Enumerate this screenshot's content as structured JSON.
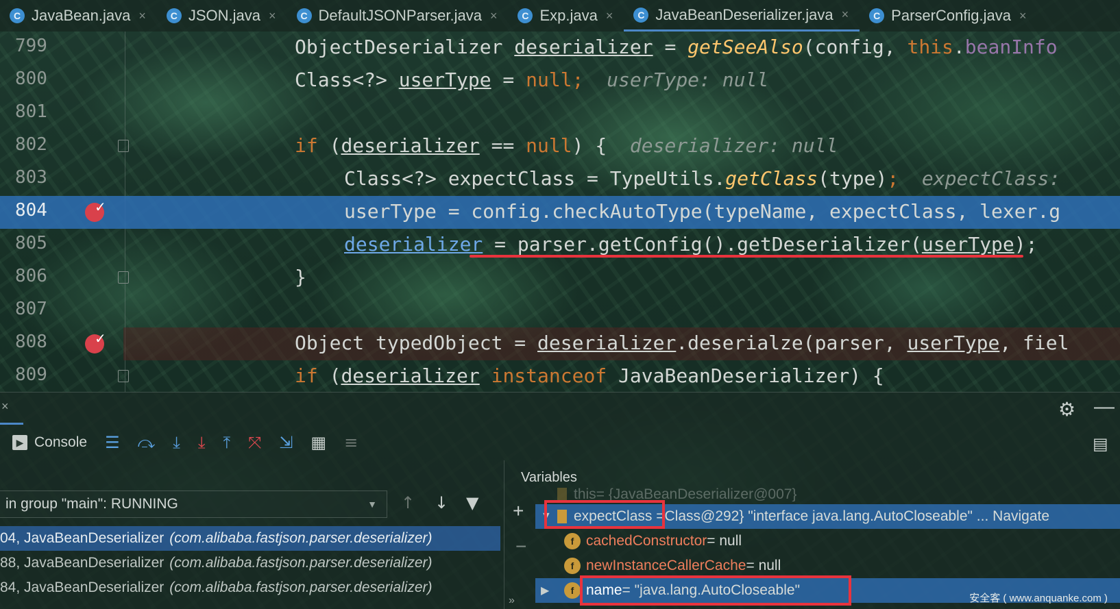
{
  "tabs": [
    {
      "icon": "C",
      "label": "JavaBean.java",
      "close": "×"
    },
    {
      "icon": "C",
      "label": "JSON.java",
      "close": "×"
    },
    {
      "icon": "C",
      "label": "DefaultJSONParser.java",
      "close": "×"
    },
    {
      "icon": "C",
      "label": "Exp.java",
      "close": "×"
    },
    {
      "icon": "C",
      "label": "JavaBeanDeserializer.java",
      "close": "×"
    },
    {
      "icon": "C",
      "label": "ParserConfig.java",
      "close": "×"
    }
  ],
  "editor": {
    "line_numbers": [
      "799",
      "800",
      "801",
      "802",
      "803",
      "804",
      "805",
      "806",
      "807",
      "808",
      "809"
    ],
    "l799": {
      "a": "ObjectDeserializer ",
      "b": "deserializer",
      "c": " = ",
      "d": "getSeeAlso",
      "e": "(config, ",
      "f": "this",
      "g": ".",
      "h": "beanInfo"
    },
    "l800": {
      "a": "Class<?> ",
      "b": "userType",
      "c": " = ",
      "d": "null",
      "e": ";",
      "hint": "userType: null"
    },
    "l802": {
      "a": "if",
      "b": " (",
      "c": "deserializer",
      "d": " == ",
      "e": "null",
      "f": ") {",
      "hint": "deserializer: null"
    },
    "l803": {
      "a": "Class<?> expectClass = TypeUtils.",
      "b": "getClass",
      "c": "(type)",
      "d": ";",
      "hint": "expectClass:"
    },
    "l804": {
      "a": "userType = config.checkAutoType(typeName, expectClass, lexer.g"
    },
    "l805": {
      "a": "deserializer",
      "b": " = parser.getConfig().getDeserializer(",
      "c": "userType",
      "d": ");"
    },
    "l806": {
      "a": "}"
    },
    "l808": {
      "a": "Object typedObject = ",
      "b": "deserializer",
      "c": ".deserialze(parser, ",
      "d": "userType",
      "e": ", fiel"
    },
    "l809": {
      "a": "if",
      "b": " (",
      "c": "deserializer",
      "d": " ",
      "e": "instanceof",
      "f": " JavaBeanDeserializer) {"
    }
  },
  "panel": {
    "console_icon": "▶",
    "console_label": "Console",
    "thread_status": "in group \"main\": RUNNING",
    "variables_title": "Variables",
    "frames": [
      {
        "left": "04, JavaBeanDeserializer",
        "pkg": "(com.alibaba.fastjson.parser.deserializer)"
      },
      {
        "left": "88, JavaBeanDeserializer",
        "pkg": "(com.alibaba.fastjson.parser.deserializer)"
      },
      {
        "left": "84, JavaBeanDeserializer",
        "pkg": "(com.alibaba.fastjson.parser.deserializer)"
      }
    ],
    "variables": [
      {
        "name": "this",
        "value": " = {JavaBeanDeserializer@007}"
      },
      {
        "name": "expectClass =",
        "value": " Class@292} \"interface java.lang.AutoCloseable\" ... Navigate"
      },
      {
        "name": "cachedConstructor",
        "value": " = null"
      },
      {
        "name": "newInstanceCallerCache",
        "value": " = null"
      },
      {
        "name": "name",
        "value": " = \"java.lang.AutoCloseable\""
      }
    ],
    "field_badge": "f",
    "frames_more": "»"
  },
  "watermark": "安全客 ( www.anquanke.com )",
  "colors": {
    "accent": "#4c87c7",
    "highlight_red": "#e8333d",
    "breakpoint": "#d9414b"
  }
}
